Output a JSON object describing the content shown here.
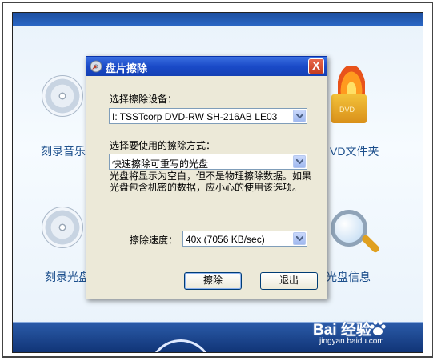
{
  "background_app": {
    "tiles": [
      {
        "label": "刻录音乐"
      },
      {
        "label": "VD文件夹"
      },
      {
        "label": "刻录光盘"
      },
      {
        "label": "光盘信息"
      }
    ],
    "folder_tag": "DVD"
  },
  "dialog": {
    "title": "盘片擦除",
    "close_label": "X",
    "device_label": "选择擦除设备：",
    "device_value": "I:  TSSTcorp DVD-RW SH-216AB  LE03",
    "method_label": "选择要使用的擦除方式：",
    "method_value": "快速擦除可重写的光盘",
    "note": "光盘将显示为空白，但不是物理擦除数据。如果光盘包含机密的数据，应小心的使用该选项。",
    "speed_label": "擦除速度：",
    "speed_value": "40x (7056 KB/sec)",
    "erase_button": "擦除",
    "exit_button": "退出"
  },
  "watermark": {
    "brand": "Bai  经验",
    "url": "jingyan.baidu.com"
  },
  "colors": {
    "title_bar": "#1a4ac8",
    "dialog_bg": "#ece9d8",
    "close_red": "#c53c1e",
    "footer_blue": "#0f3274"
  },
  "icons": [
    "disc-icon",
    "folder-icon",
    "flame-icon",
    "magnifier-icon",
    "close-icon",
    "dropdown-arrow-icon",
    "paw-icon"
  ]
}
